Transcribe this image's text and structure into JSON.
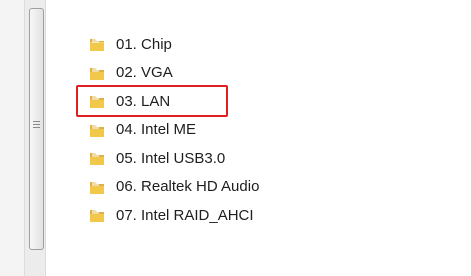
{
  "colors": {
    "highlight_border": "#e02020",
    "text": "#1e1e1e",
    "folder_yellow": "#f2c84b"
  },
  "icons": {
    "folder": "folder-icon",
    "grip": "scrollbar-grip-icon"
  },
  "files": [
    {
      "name": "01. Chip",
      "selected": false
    },
    {
      "name": "02. VGA",
      "selected": false
    },
    {
      "name": "03. LAN",
      "selected": true
    },
    {
      "name": "04. Intel ME",
      "selected": false
    },
    {
      "name": "05. Intel USB3.0",
      "selected": false
    },
    {
      "name": "06. Realtek HD Audio",
      "selected": false
    },
    {
      "name": "07. Intel RAID_AHCI",
      "selected": false
    }
  ]
}
